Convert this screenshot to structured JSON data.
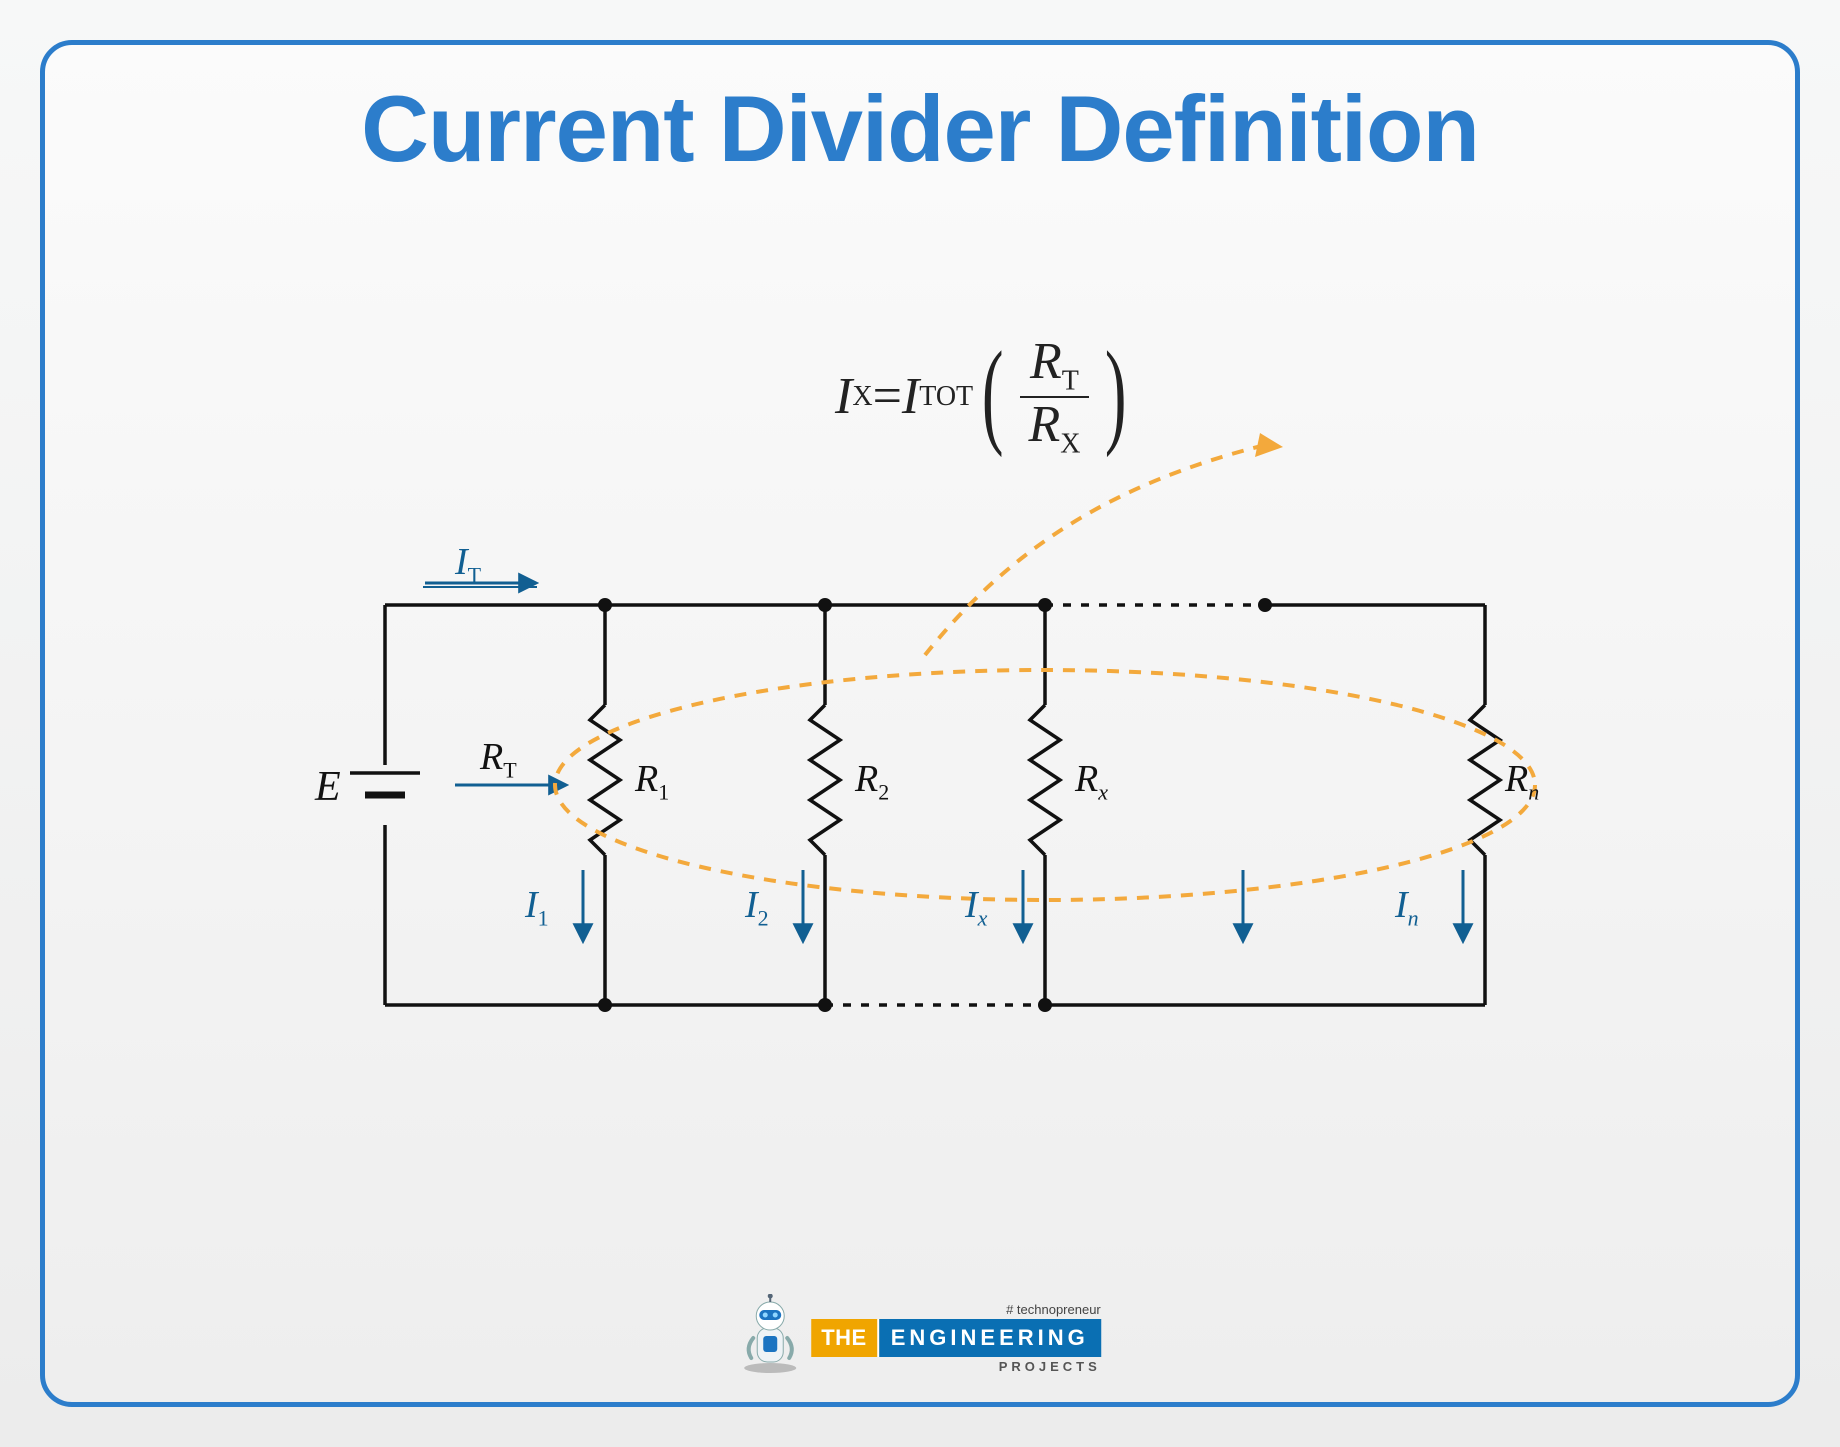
{
  "title": "Current Divider Definition",
  "formula": {
    "left_var": "I",
    "left_sub": "X",
    "eq": " = ",
    "right_var": "I",
    "right_sub": "TOT",
    "num_var": "R",
    "num_sub": "T",
    "den_var": "R",
    "den_sub": "X"
  },
  "circuit": {
    "source_label": "E",
    "rt_label": "R",
    "rt_sub": "T",
    "it_label": "I",
    "it_sub": "T",
    "branches": [
      {
        "r": "R",
        "rsub": "1",
        "i": "I",
        "isub": "1"
      },
      {
        "r": "R",
        "rsub": "2",
        "i": "I",
        "isub": "2"
      },
      {
        "r": "R",
        "rsub": "x",
        "i": "I",
        "isub": "x"
      },
      {
        "r": "R",
        "rsub": "n",
        "i": "I",
        "isub": "n"
      }
    ]
  },
  "logo": {
    "tagline": "# technopreneur",
    "the": "THE",
    "engineering": "ENGINEERING",
    "projects": "PROJECTS"
  }
}
